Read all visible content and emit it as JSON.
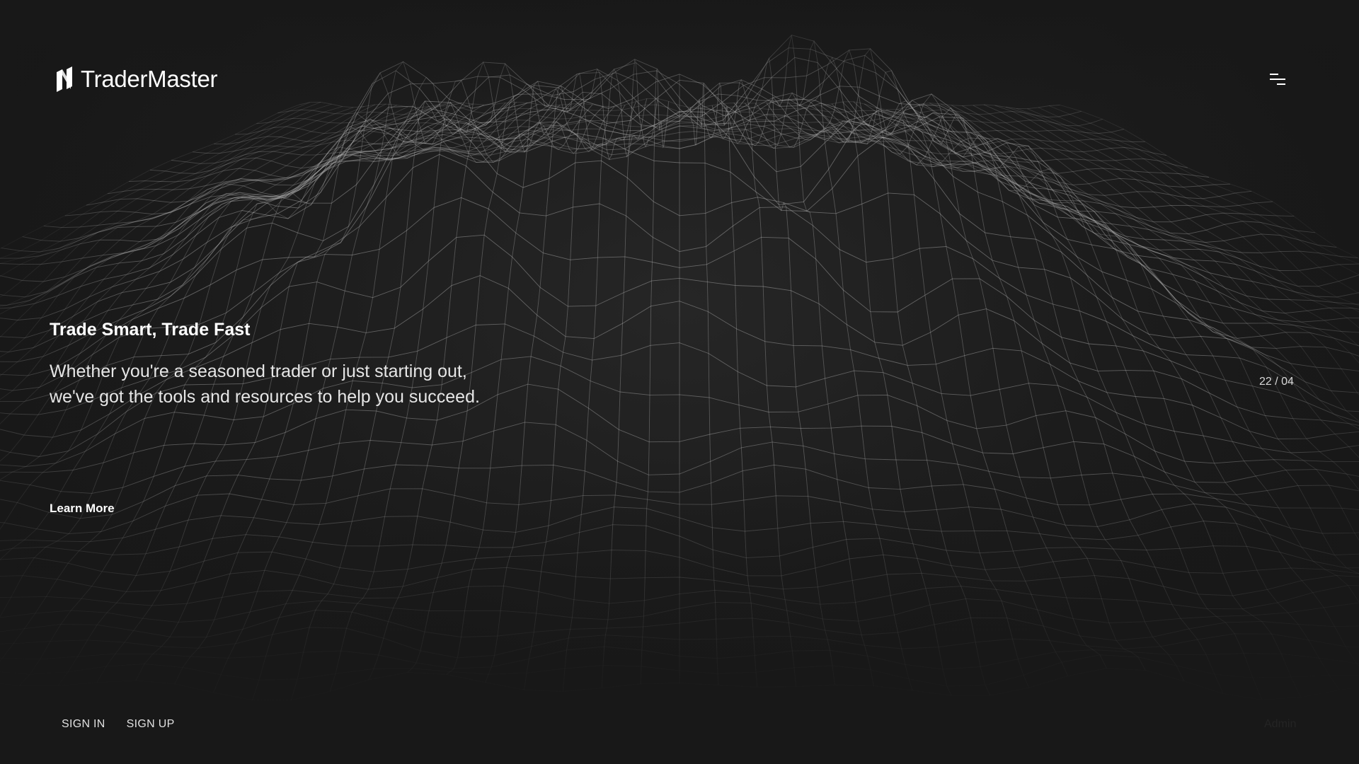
{
  "brand": {
    "name": "TraderMaster",
    "logo_icon": "tradermaster-logo-icon"
  },
  "header": {
    "menu_icon": "menu-icon"
  },
  "hero": {
    "title": "Trade Smart, Trade Fast",
    "subtitle": "Whether you're a seasoned trader or just starting out, we've got the tools and resources to help you succeed.",
    "cta_label": "Learn More"
  },
  "slider": {
    "counter": "22 / 04"
  },
  "footer": {
    "sign_in_label": "SIGN IN",
    "sign_up_label": "SIGN UP",
    "admin_label": "Admin"
  },
  "background": {
    "type": "wireframe-terrain-mesh"
  },
  "colors": {
    "background": "#1a1a1a",
    "text_primary": "#ffffff",
    "mesh_line": "#bfbfbf"
  }
}
